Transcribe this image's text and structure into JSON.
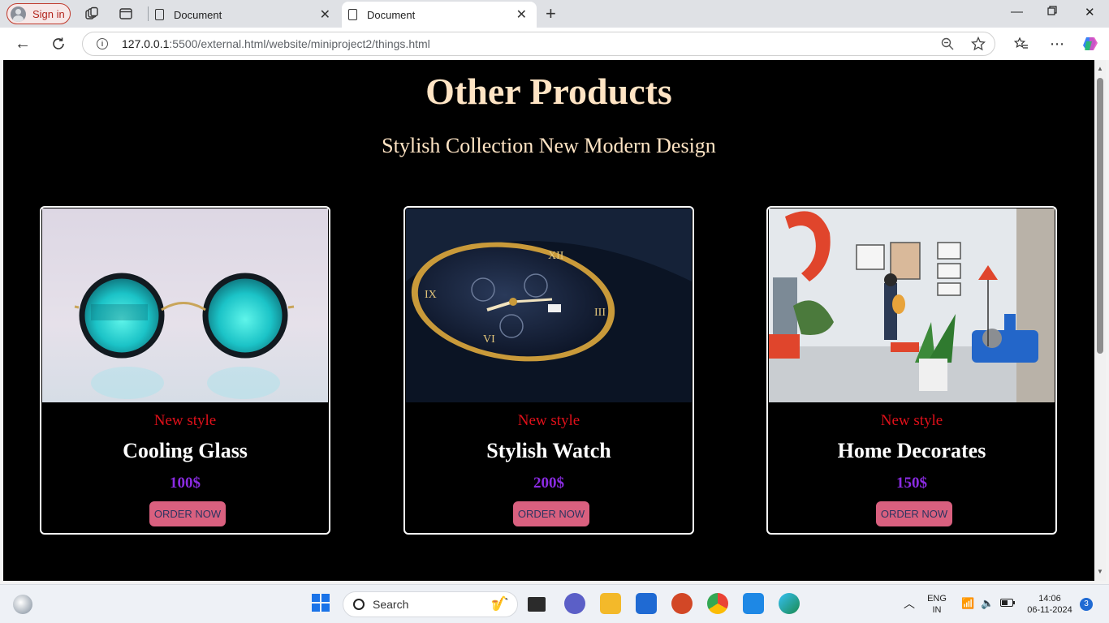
{
  "browser": {
    "sign_in_label": "Sign in",
    "tabs": [
      {
        "title": "Document"
      },
      {
        "title": "Document"
      }
    ],
    "address": {
      "host": "127.0.0.1",
      "path": ":5500/external.html/website/miniproject2/things.html"
    }
  },
  "page": {
    "title": "Other Products",
    "subtitle": "Stylish Collection New Modern Design",
    "products": [
      {
        "tag": "New style",
        "name": "Cooling Glass",
        "price": "100$",
        "button": "ORDER NOW"
      },
      {
        "tag": "New style",
        "name": "Stylish Watch",
        "price": "200$",
        "button": "ORDER NOW"
      },
      {
        "tag": "New style",
        "name": "Home Decorates",
        "price": "150$",
        "button": "ORDER NOW"
      }
    ]
  },
  "taskbar": {
    "search_label": "Search",
    "language_line1": "ENG",
    "language_line2": "IN",
    "time": "14:06",
    "date": "06-11-2024",
    "notification_count": "3"
  }
}
